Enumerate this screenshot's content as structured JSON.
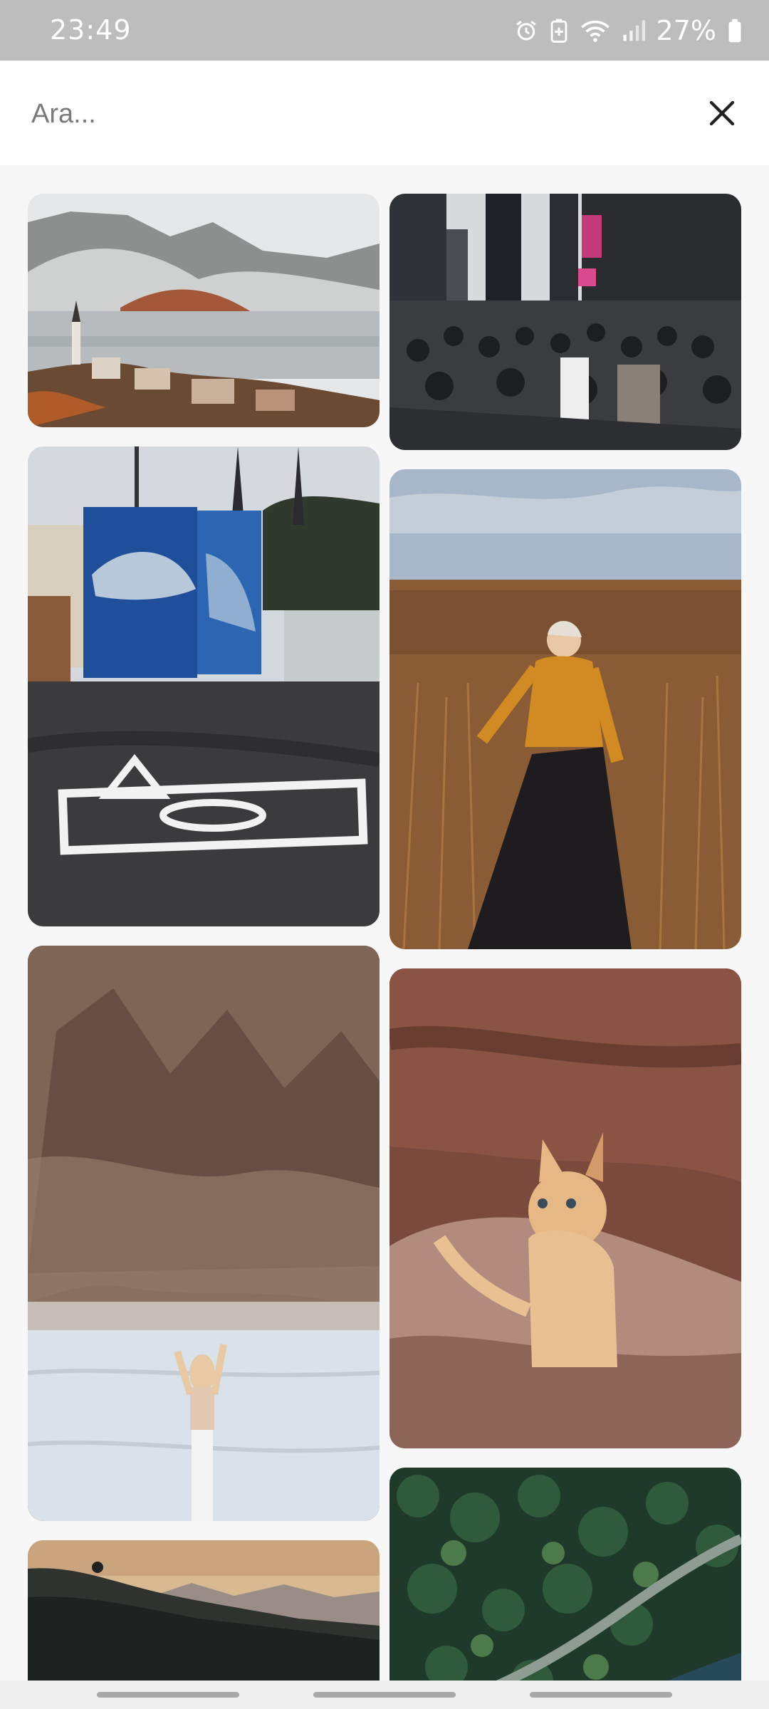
{
  "status_bar": {
    "time": "23:49",
    "battery": "27%",
    "icons": [
      "alarm-icon",
      "battery-saver-icon",
      "wifi-icon",
      "signal-icon",
      "battery-icon"
    ]
  },
  "search": {
    "placeholder": "Ara...",
    "value": "",
    "close_icon": "close-icon"
  },
  "photos": {
    "left_column": [
      {
        "subject": "hallstatt-lake"
      },
      {
        "subject": "shark-mural-camera-graffiti"
      },
      {
        "subject": "woman-salt-flat-mountain"
      },
      {
        "subject": "hills-sunset"
      }
    ],
    "right_column": [
      {
        "subject": "city-street-crowd"
      },
      {
        "subject": "woman-wheat-field"
      },
      {
        "subject": "cat-on-rock"
      },
      {
        "subject": "aerial-forest-road"
      }
    ]
  },
  "nav_bar": {
    "handles": [
      "recents-handle",
      "home-handle",
      "back-handle"
    ]
  }
}
